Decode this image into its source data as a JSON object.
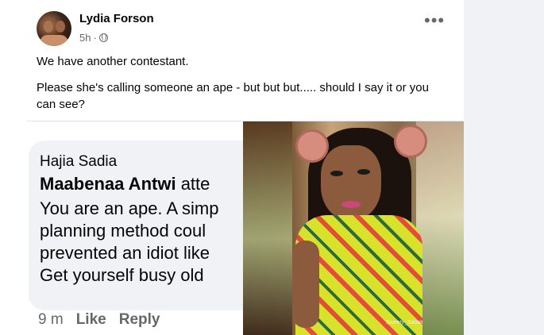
{
  "post": {
    "author": "Lydia Forson",
    "time": "5h",
    "separator": "·",
    "more": "•••",
    "line1": "We have another contestant.",
    "line2": "Please she's calling someone an ape - but but but..... should I say it or you can see?"
  },
  "comment": {
    "author": "Hajia Sadia",
    "mention": "Maabenaa Antwi",
    "mention_rest": "atte",
    "lines": [
      "You are an ape. A simp",
      "planning method coul",
      "prevented an idiot like",
      "Get yourself busy old"
    ],
    "time": "9 m",
    "like": "Like",
    "reply": "Reply"
  },
  "photo": {
    "watermark": "Sweety_Sabali"
  }
}
